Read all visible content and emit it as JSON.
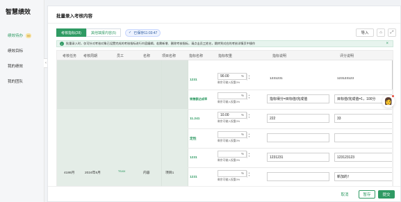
{
  "app": {
    "brand": "智慧绩效"
  },
  "sidebar": {
    "items": [
      {
        "label": "绩效待办",
        "badge": "99",
        "active": true
      },
      {
        "label": "绩效目标"
      },
      {
        "label": "我的绩效"
      },
      {
        "label": "我的团队"
      }
    ]
  },
  "page": {
    "title": "批量录入考核内容"
  },
  "tabs": [
    {
      "label": "考核指标(28)"
    },
    {
      "label": "其他填报内容(5)"
    }
  ],
  "saved": {
    "label": "已保存11:03:47"
  },
  "toolbar": {
    "import_label": "导入"
  },
  "notice": {
    "text": "批量录入时，仅可针对考核对象已设置完成的考核指标进行内容编辑，若需新增、删除考核指标，请点击员工姓名，跳转到对应的考核详情页中操作"
  },
  "table": {
    "headers": [
      "考核任务",
      "考核周期",
      "员工",
      "名称",
      "项目名称",
      "指标名称",
      "指标权重",
      "指标说明",
      "评分说明"
    ],
    "left": {
      "task": "4186月",
      "period": "2024年6月",
      "employee": "Yuxx",
      "name": "内容",
      "project": "项目1"
    },
    "rows": [
      {
        "metric": "1231",
        "weight": "90.00",
        "remain": "剩余可输入权重0%",
        "desc": "1231231",
        "score": "123123123",
        "desc_input": false
      },
      {
        "metric": "销售额达成率",
        "weight": "",
        "remain": "剩余可输入权重0%",
        "desc": "指标得分=目标值/完成值",
        "score": "目标值/完成值=1，100分",
        "desc_input": true
      },
      {
        "metric": "11.241",
        "weight": "10.00",
        "remain": "剩余可输入权重0%",
        "desc": "222",
        "score": "33",
        "desc_input": true
      },
      {
        "metric": "定性",
        "weight": "",
        "remain": "剩余可输入权重0%",
        "desc": "",
        "score": "",
        "desc_input": true
      },
      {
        "metric": "1231",
        "weight": "",
        "remain": "剩余可输入权重0%",
        "desc": "1231231",
        "score": "123123123",
        "desc_input": true
      },
      {
        "metric": "1231",
        "weight": "",
        "remain": "剩余可输入权重0%",
        "desc": "",
        "score": "新加的！",
        "desc_input": true
      }
    ]
  },
  "footer": {
    "cancel": "取消",
    "save": "暂存",
    "submit": "提交"
  },
  "icons": {
    "saved": "check-icon",
    "filter": "filter-icon",
    "expand": "expand-icon",
    "info": "info-icon",
    "close": "close-icon",
    "assistant": "assistant-avatar-icon"
  },
  "colors": {
    "accent": "#2f9a63"
  }
}
